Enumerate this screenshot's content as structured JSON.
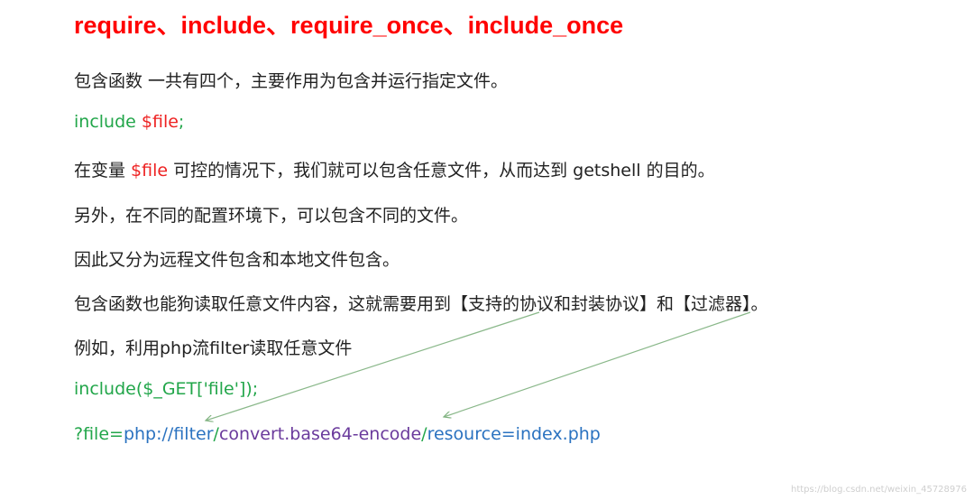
{
  "title": "require、include、require_once、include_once",
  "lines": {
    "l1": "包含函数 一共有四个，主要作用为包含并运行指定文件。",
    "l2": {
      "code": "include ",
      "var": "$file",
      "semi": ";"
    },
    "l3": {
      "pre": "在变量 ",
      "var": "$file",
      "post": " 可控的情况下，我们就可以包含任意文件，从而达到 getshell 的目的。"
    },
    "l4": "另外，在不同的配置环境下，可以包含不同的文件。",
    "l5": "因此又分为远程文件包含和本地文件包含。",
    "l6": "包含函数也能狗读取任意文件内容，这就需要用到【支持的协议和封装协议】和【过滤器】。",
    "l7": "例如，利用php流filter读取任意文件",
    "l8": "include($_GET['file']);",
    "l9": {
      "p1": "?file=",
      "p2": "php://filter",
      "p3": "/",
      "p4": "convert.base64-encode",
      "p5": "/",
      "p6": "resource=index.php"
    }
  },
  "watermark": "https://blog.csdn.net/weixin_45728976",
  "colors": {
    "title": "#ff0000",
    "green": "#22a64a",
    "red": "#ee2222",
    "blue": "#2a72c0",
    "purple": "#6a3a9c"
  }
}
